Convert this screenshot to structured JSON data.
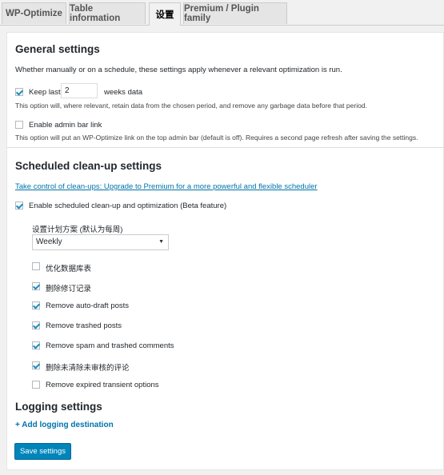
{
  "tabs": [
    "WP-Optimize",
    "Table information",
    "设置",
    "Premium / Plugin family"
  ],
  "general": {
    "title": "General settings",
    "desc": "Whether manually or on a schedule, these settings apply whenever a relevant optimization is run.",
    "keep_last_label": "Keep last",
    "keep_last_value": "2",
    "keep_last_unit": "weeks data",
    "keep_last_help": "This option will, where relevant, retain data from the chosen period, and remove any garbage data before that period.",
    "admin_bar_label": "Enable admin bar link",
    "admin_bar_help": "This option will put an WP-Optimize link on the top admin bar (default is off). Requires a second page refresh after saving the settings."
  },
  "scheduled": {
    "title": "Scheduled clean-up settings",
    "upgrade_link": "Take control of clean-ups: Upgrade to Premium for a more powerful and flexible scheduler",
    "enable_label": "Enable scheduled clean-up and optimization (Beta feature)",
    "schedule_label": "设置计划方案 (默认为每周)",
    "schedule_value": "Weekly",
    "options": [
      {
        "label": "优化数据库表",
        "checked": false
      },
      {
        "label": "删除修订记录",
        "checked": true
      },
      {
        "label": "Remove auto-draft posts",
        "checked": true
      },
      {
        "label": "Remove trashed posts",
        "checked": true
      },
      {
        "label": "Remove spam and trashed comments",
        "checked": true
      },
      {
        "label": "删除未清除未审核的评论",
        "checked": true
      },
      {
        "label": "Remove expired transient options",
        "checked": false
      }
    ]
  },
  "logging": {
    "title": "Logging settings",
    "add_link": "+ Add logging destination"
  },
  "save_label": "Save settings"
}
